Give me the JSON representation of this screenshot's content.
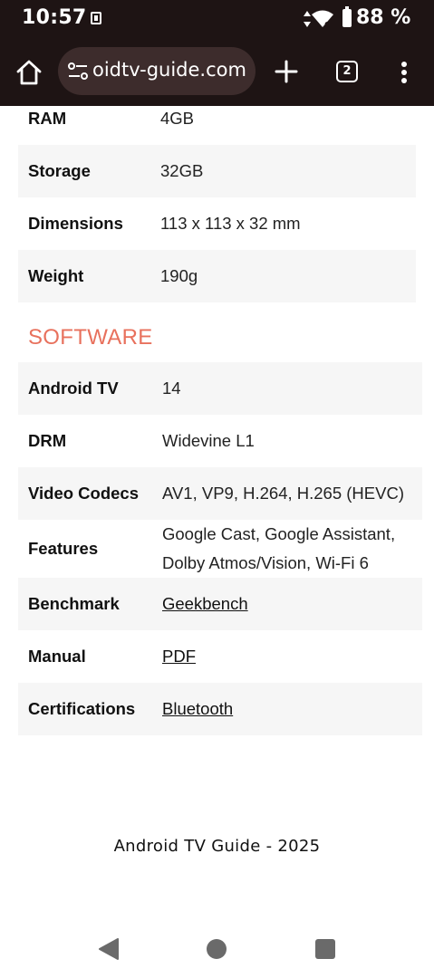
{
  "status_bar": {
    "time": "10:57",
    "battery": "88 %",
    "icons": [
      "notification-icon",
      "mobile-data-icon",
      "wifi-icon",
      "battery-icon"
    ]
  },
  "browser": {
    "url": "oidtv-guide.com",
    "tab_count": "2",
    "icons": [
      "home-icon",
      "site-settings-icon",
      "plus-icon",
      "tab-switcher-icon",
      "more-vert-icon"
    ]
  },
  "hardware_rows": [
    {
      "label": "RAM",
      "value": "4GB"
    },
    {
      "label": "Storage",
      "value": "32GB"
    },
    {
      "label": "Dimensions",
      "value": "113 x 113 x 32 mm"
    },
    {
      "label": "Weight",
      "value": "190g"
    }
  ],
  "software": {
    "heading": "SOFTWARE",
    "rows": [
      {
        "label": "Android TV",
        "value": "14"
      },
      {
        "label": "DRM",
        "value": "Widevine L1"
      },
      {
        "label": "Video Codecs",
        "value": "AV1, VP9, H.264, H.265 (HEVC)"
      },
      {
        "label": "Features",
        "value_line1": "Google Cast, Google Assistant,",
        "value_line2": "Dolby Atmos/Vision, Wi-Fi 6"
      },
      {
        "label": "Benchmark",
        "value": "Geekbench",
        "link": true
      },
      {
        "label": "Manual",
        "value": "PDF",
        "link": true
      },
      {
        "label": "Certifications",
        "value": "Bluetooth",
        "link": true
      }
    ]
  },
  "footer": {
    "text": "Android TV Guide - 2025"
  },
  "colors": {
    "accent": "#e8715d",
    "toolbar_bg": "#1e1414",
    "url_bar_bg": "#3d2c2c",
    "row_alt_bg": "#f6f6f6"
  },
  "nav_bar": {
    "icons": [
      "back-icon",
      "home-circle-icon",
      "recents-icon"
    ]
  }
}
